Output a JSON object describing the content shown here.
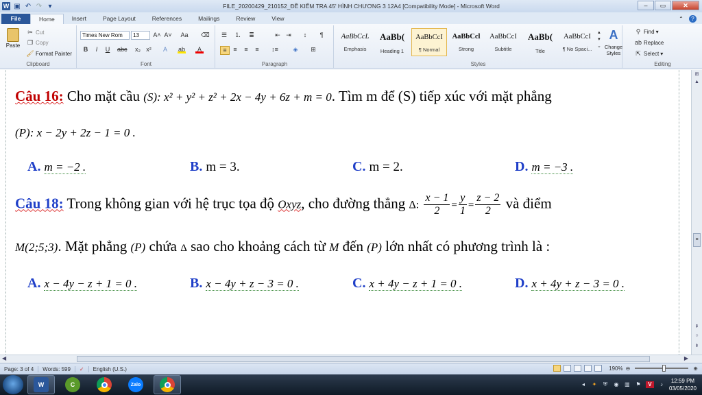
{
  "window": {
    "title": "FILE_20200429_210152_ĐỀ KIỂM TRA 45' HÌNH CHƯƠNG 3 12A4 [Compatibility Mode]  -  Microsoft Word",
    "controls": {
      "minimize": "–",
      "maximize": "▭",
      "close": "✕"
    }
  },
  "tabs": [
    "File",
    "Home",
    "Insert",
    "Page Layout",
    "References",
    "Mailings",
    "Review",
    "View"
  ],
  "ribbon": {
    "clipboard": {
      "paste": "Paste",
      "cut": "Cut",
      "copy": "Copy",
      "format_painter": "Format Painter",
      "label": "Clipboard"
    },
    "font": {
      "name": "Times New Rom",
      "size": "13",
      "label": "Font"
    },
    "paragraph": {
      "label": "Paragraph"
    },
    "styles": {
      "label": "Styles",
      "items": [
        {
          "sample": "AaBbCcL",
          "name": "Emphasis"
        },
        {
          "sample": "AaBb(",
          "name": "Heading 1"
        },
        {
          "sample": "AaBbCcI",
          "name": "¶ Normal"
        },
        {
          "sample": "AaBbCcl",
          "name": "Strong"
        },
        {
          "sample": "AaBbCcI",
          "name": "Subtitle"
        },
        {
          "sample": "AaBb(",
          "name": "Title"
        },
        {
          "sample": "AaBbCcI",
          "name": "¶ No Spaci..."
        }
      ],
      "change_styles": "Change Styles"
    },
    "editing": {
      "find": "Find",
      "replace": "Replace",
      "select": "Select",
      "label": "Editing"
    }
  },
  "document": {
    "q16": {
      "label": "Câu 16:",
      "text": "Cho mặt cầu",
      "equation": "(S): x² + y² + z² + 2x − 4y + 6z + m = 0",
      "text2": ". Tìm m để (S) tiếp xúc với mặt phẳng",
      "plane": "(P): x − 2y + 2z − 1 = 0 .",
      "answers": [
        {
          "letter": "A.",
          "value": "m = −2 ."
        },
        {
          "letter": "B.",
          "value": "m = 3."
        },
        {
          "letter": "C.",
          "value": "m = 2."
        },
        {
          "letter": "D.",
          "value": "m = −3 ."
        }
      ]
    },
    "q18": {
      "label": "Câu 18:",
      "text": "Trong không gian với hệ trục tọa độ",
      "oxyz": "Oxyz",
      "text2": ", cho đường thẳng",
      "delta": "Δ:",
      "frac1": {
        "num": "x − 1",
        "den": "2"
      },
      "frac2": {
        "num": "y",
        "den": "1"
      },
      "frac3": {
        "num": "z − 2",
        "den": "2"
      },
      "text3": "và điểm",
      "point": "M(2;5;3)",
      "text4": ". Mặt phẳng",
      "p": "(P)",
      "text5": "chứa",
      "delta2": "Δ",
      "text6": "sao cho khoảng cách từ",
      "m": "M",
      "text7": "đến",
      "p2": "(P)",
      "text8": "lớn nhất có phương trình là :",
      "answers": [
        {
          "letter": "A.",
          "value": "x − 4y − z + 1 = 0 ."
        },
        {
          "letter": "B.",
          "value": "x − 4y + z − 3 = 0 ."
        },
        {
          "letter": "C.",
          "value": "x + 4y − z + 1 = 0 ."
        },
        {
          "letter": "D.",
          "value": "x + 4y + z − 3 = 0 ."
        }
      ]
    }
  },
  "status": {
    "page": "Page: 3 of 4",
    "words": "Words: 599",
    "language": "English (U.S.)",
    "zoom": "190%",
    "zoom_level": 0.55
  },
  "taskbar": {
    "apps": [
      "Word",
      "CCleaner",
      "Chrome",
      "Zalo",
      "Chrome"
    ],
    "lang": "V",
    "time": "12:59 PM",
    "date": "03/05/2020"
  }
}
